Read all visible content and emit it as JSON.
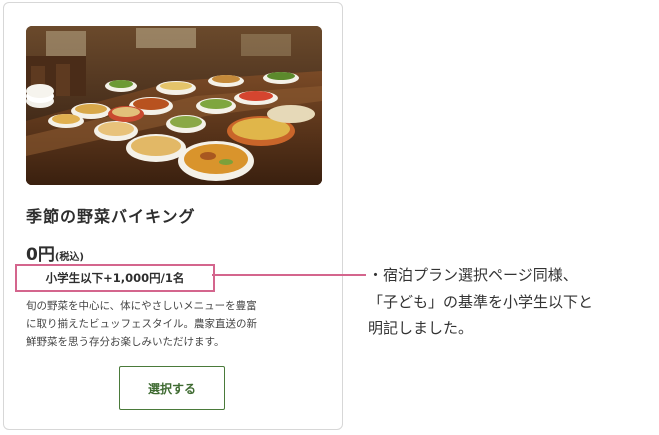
{
  "card": {
    "image_alt": "buffet-photo",
    "title": "季節の野菜バイキング",
    "price": "0円",
    "tax_note": "(税込)",
    "child_price": "小学生以下+1,000円/1名",
    "description_lines": [
      "旬の野菜を中心に、体にやさしいメニューを豊富",
      "に取り揃えたビュッフェスタイル。農家直送の新",
      "鮮野菜を思う存分お楽しみいただけます。"
    ],
    "select_button": "選択する"
  },
  "annotation": {
    "lines": [
      "・宿泊プラン選択ページ同様、",
      "「子ども」の基準を小学生以下と",
      "明記しました。"
    ],
    "highlight_color": "#d4658d"
  },
  "colors": {
    "accent_green": "#4a7a3a",
    "highlight_pink": "#d4658d"
  }
}
